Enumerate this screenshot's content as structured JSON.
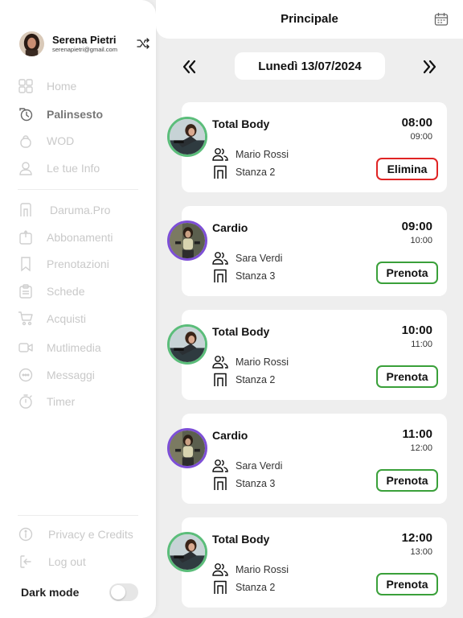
{
  "app": {
    "page_title": "Principale"
  },
  "colors": {
    "accent_green": "#3aa03a",
    "danger_red": "#e02424",
    "ring_purple": "#7d4fd6",
    "ring_green": "#5bbd7a"
  },
  "profile": {
    "name": "Serena Pietri",
    "email": "serenapietri@gmail.com"
  },
  "nav_primary": [
    {
      "label": "Home",
      "icon": "grid-icon"
    },
    {
      "label": "Palinsesto",
      "icon": "schedule-icon",
      "active": true
    },
    {
      "label": "WOD",
      "icon": "kettlebell-icon"
    },
    {
      "label": "Le tue Info",
      "icon": "user-icon"
    }
  ],
  "nav_secondary": [
    {
      "label": "Daruma.Pro",
      "icon": "door-icon"
    },
    {
      "label": "Abbonamenti",
      "icon": "subscription-icon"
    },
    {
      "label": "Prenotazioni",
      "icon": "bookmark-icon"
    },
    {
      "label": "Schede",
      "icon": "clipboard-icon"
    },
    {
      "label": "Acquisti",
      "icon": "cart-icon"
    },
    {
      "label": "Mutlimedia",
      "icon": "video-icon"
    },
    {
      "label": "Messaggi",
      "icon": "chat-icon"
    },
    {
      "label": "Timer",
      "icon": "stopwatch-icon"
    }
  ],
  "nav_footer": [
    {
      "label": "Privacy e Credits",
      "icon": "info-icon"
    },
    {
      "label": "Log out",
      "icon": "logout-icon"
    }
  ],
  "dark_mode": {
    "label": "Dark mode",
    "enabled": false
  },
  "date_nav": {
    "current": "Lunedì 13/07/2024"
  },
  "classes": [
    {
      "title": "Total Body",
      "start": "08:00",
      "end": "09:00",
      "trainer": "Mario Rossi",
      "room": "Stanza 2",
      "action": "Elimina",
      "action_type": "danger",
      "ring": "green"
    },
    {
      "title": "Cardio",
      "start": "09:00",
      "end": "10:00",
      "trainer": "Sara Verdi",
      "room": "Stanza 3",
      "action": "Prenota",
      "action_type": "book",
      "ring": "purple"
    },
    {
      "title": "Total Body",
      "start": "10:00",
      "end": "11:00",
      "trainer": "Mario Rossi",
      "room": "Stanza 2",
      "action": "Prenota",
      "action_type": "book",
      "ring": "green"
    },
    {
      "title": "Cardio",
      "start": "11:00",
      "end": "12:00",
      "trainer": "Sara Verdi",
      "room": "Stanza 3",
      "action": "Prenota",
      "action_type": "book",
      "ring": "purple"
    },
    {
      "title": "Total Body",
      "start": "12:00",
      "end": "13:00",
      "trainer": "Mario Rossi",
      "room": "Stanza 2",
      "action": "Prenota",
      "action_type": "book",
      "ring": "green"
    }
  ]
}
